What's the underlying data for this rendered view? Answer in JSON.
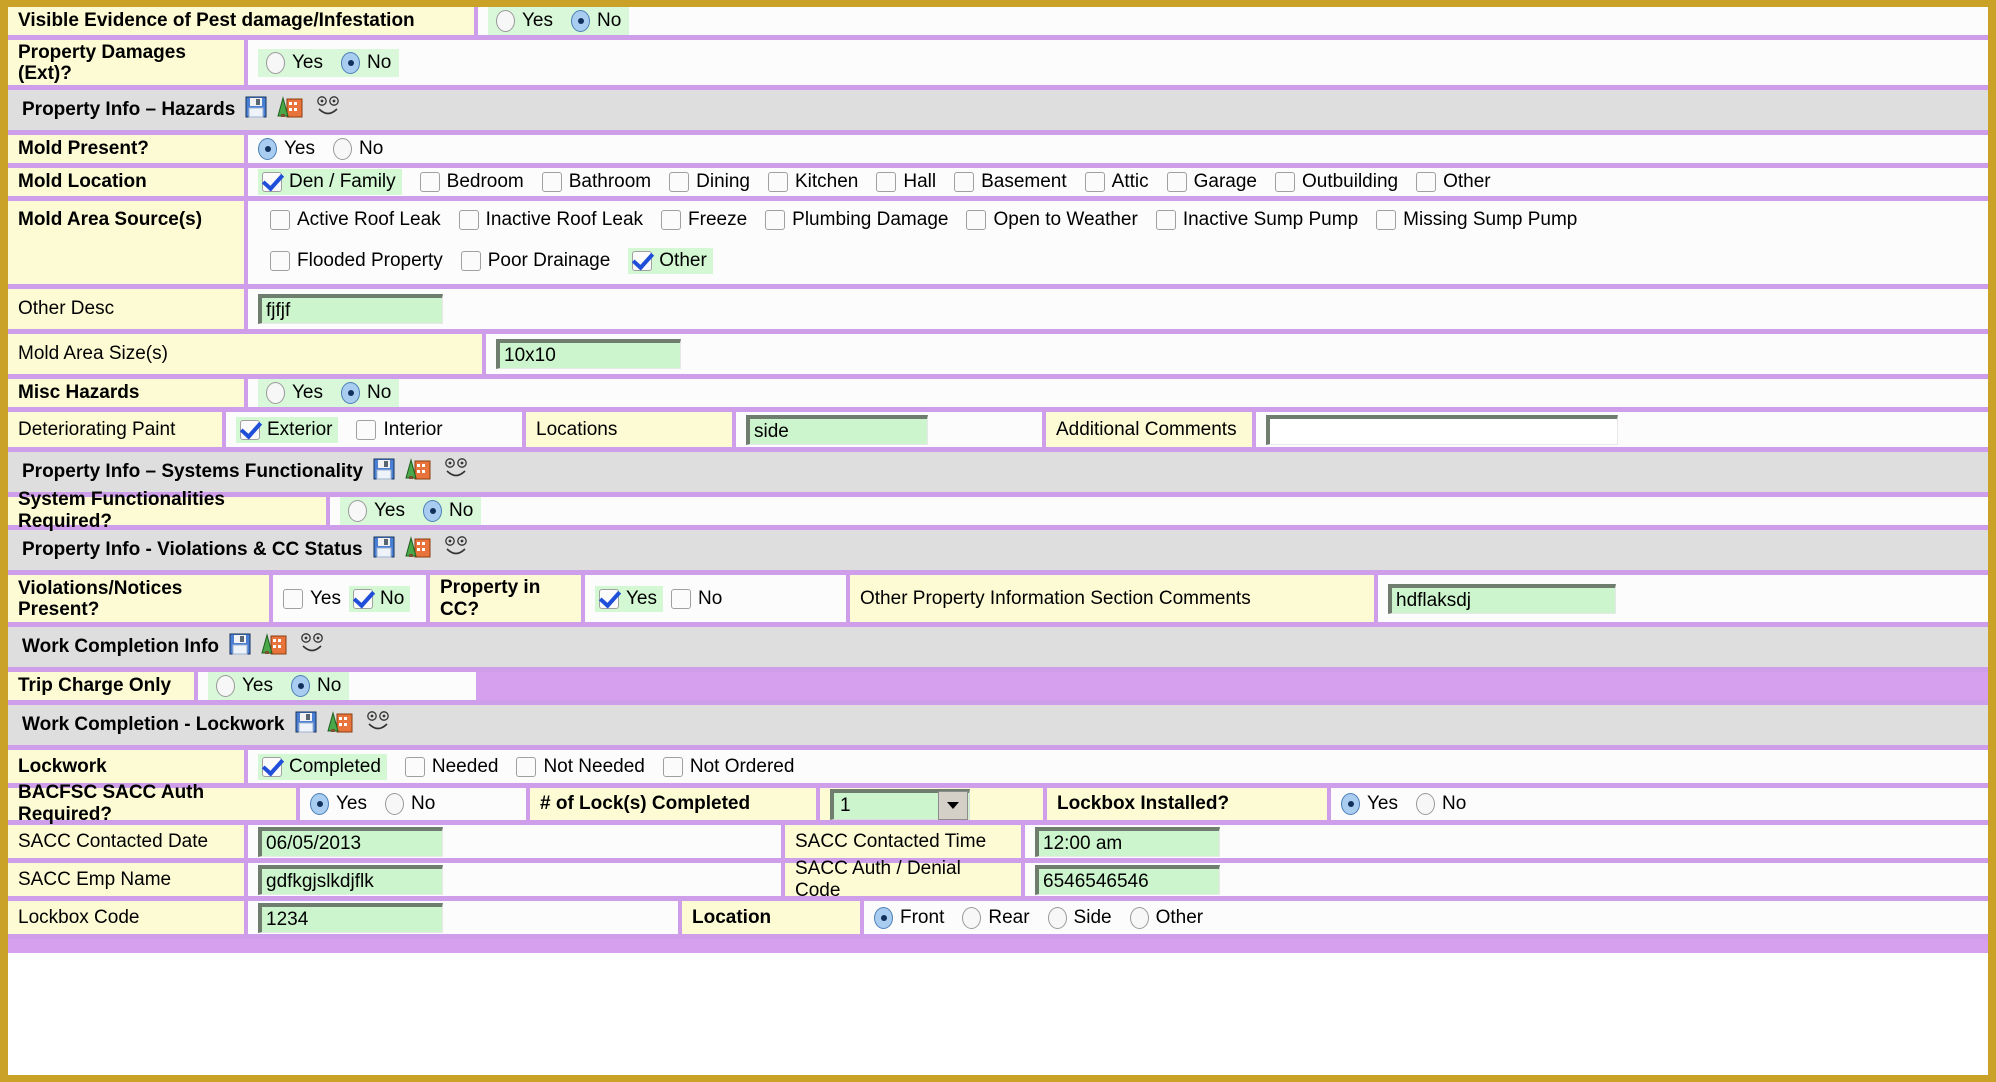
{
  "rows": {
    "pest": {
      "label": "Visible Evidence of Pest damage/Infestation",
      "yes": "Yes",
      "no": "No",
      "selected": "No"
    },
    "property_damages": {
      "label": "Property Damages (Ext)?",
      "yes": "Yes",
      "no": "No",
      "selected": "No"
    },
    "mold_present": {
      "label": "Mold Present?",
      "yes": "Yes",
      "no": "No",
      "selected": "Yes"
    },
    "mold_location": {
      "label": "Mold Location",
      "options": [
        "Den / Family",
        "Bedroom",
        "Bathroom",
        "Dining",
        "Kitchen",
        "Hall",
        "Basement",
        "Attic",
        "Garage",
        "Outbuilding",
        "Other"
      ],
      "checked": [
        "Den / Family"
      ]
    },
    "mold_sources": {
      "label": "Mold Area Source(s)",
      "row1": [
        "Active Roof Leak",
        "Inactive Roof Leak",
        "Freeze",
        "Plumbing Damage",
        "Open to Weather",
        "Inactive Sump Pump",
        "Missing Sump Pump"
      ],
      "row2": [
        "Flooded Property",
        "Poor Drainage",
        "Other"
      ],
      "checked": [
        "Other"
      ]
    },
    "other_desc": {
      "label": "Other Desc",
      "value": "fjfjf"
    },
    "mold_area_size": {
      "label": "Mold Area Size(s)",
      "value": "10x10"
    },
    "misc_hazards": {
      "label": "Misc Hazards",
      "yes": "Yes",
      "no": "No",
      "selected": "No"
    },
    "deteriorating_paint": {
      "label": "Deteriorating Paint",
      "exterior": "Exterior",
      "interior": "Interior",
      "checked": [
        "Exterior"
      ],
      "locations_label": "Locations",
      "locations_value": "side",
      "comments_label": "Additional Comments",
      "comments_value": ""
    },
    "system_functionalities": {
      "label": "System Functionalities Required?",
      "yes": "Yes",
      "no": "No",
      "selected": "No"
    },
    "violations": {
      "label": "Violations/Notices Present?",
      "yes": "Yes",
      "no": "No",
      "checked": "No"
    },
    "property_cc": {
      "label": "Property in CC?",
      "yes": "Yes",
      "no": "No",
      "checked": "Yes"
    },
    "other_section_comments": {
      "label": "Other Property Information Section Comments",
      "value": "hdflaksdj"
    },
    "trip_charge": {
      "label": "Trip Charge Only",
      "yes": "Yes",
      "no": "No",
      "selected": "No"
    },
    "lockwork": {
      "label": "Lockwork",
      "options": [
        "Completed",
        "Needed",
        "Not Needed",
        "Not Ordered"
      ],
      "checked": [
        "Completed"
      ]
    },
    "bacfsc": {
      "label": "BACFSC SACC Auth Required?",
      "yes": "Yes",
      "no": "No",
      "selected": "Yes"
    },
    "locks_completed": {
      "label": "# of Lock(s) Completed",
      "value": "1"
    },
    "lockbox_installed": {
      "label": "Lockbox Installed?",
      "yes": "Yes",
      "no": "No",
      "selected": "Yes"
    },
    "sacc_contacted_date": {
      "label": "SACC Contacted Date",
      "value": "06/05/2013"
    },
    "sacc_contacted_time": {
      "label": "SACC Contacted Time",
      "value": "12:00 am"
    },
    "sacc_emp_name": {
      "label": "SACC Emp Name",
      "value": "gdfkgjslkdjflk"
    },
    "sacc_auth_code": {
      "label": "SACC Auth / Denial Code",
      "value": "6546546546"
    },
    "lockbox_code": {
      "label": "Lockbox Code",
      "value": "1234"
    },
    "location": {
      "label": "Location",
      "options": [
        "Front",
        "Rear",
        "Side",
        "Other"
      ],
      "selected": "Front"
    }
  },
  "sections": {
    "hazards": "Property Info – Hazards",
    "systems": "Property Info – Systems Functionality",
    "violations": "Property Info - Violations & CC Status",
    "work_completion": "Work Completion Info",
    "lockwork": "Work Completion - Lockwork"
  },
  "colors": {
    "label_bg": "#fdfbd4",
    "section_bg": "#dedede",
    "border": "#cf9eea",
    "input_bg": "#cdf5cd",
    "highlight": "#d3f8d3",
    "page_border": "#c9a227"
  }
}
